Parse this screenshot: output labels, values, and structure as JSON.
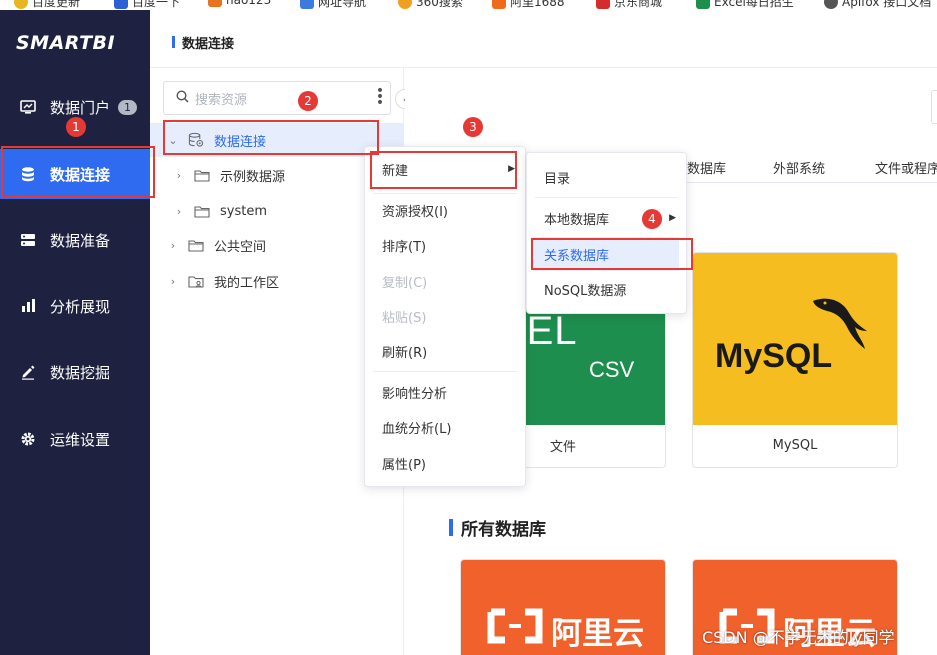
{
  "bookmarks": [
    {
      "label": "百度更新",
      "icon": "chrome-icon",
      "color": "#e8b623"
    },
    {
      "label": "百度一下",
      "icon": "baidu-icon",
      "color": "#2f5fd6"
    },
    {
      "label": "hao123",
      "icon": "hao123-icon",
      "color": "#e8741f"
    },
    {
      "label": "网址导航",
      "icon": "nav-icon",
      "color": "#3b7be0"
    },
    {
      "label": "360搜索",
      "icon": "360-icon",
      "color": "#f0a020"
    },
    {
      "label": "阿里1688",
      "icon": "1688-icon",
      "color": "#f06a1c"
    },
    {
      "label": "京东商城",
      "icon": "jd-icon",
      "color": "#d42b2b"
    },
    {
      "label": "Excel每日招生",
      "icon": "excel-icon",
      "color": "#1d8f4d"
    },
    {
      "label": "Apifox 接口文档",
      "icon": "apifox-icon",
      "color": "#555555"
    }
  ],
  "brand": {
    "logo": "SMARTBI",
    "nav_bg": "#1e2240",
    "accent": "#2f6bf0"
  },
  "nav": {
    "items": [
      {
        "label": "数据门户",
        "badge": "1",
        "icon": "portal-icon"
      },
      {
        "label": "数据连接",
        "icon": "database-icon"
      },
      {
        "label": "数据准备",
        "icon": "prepare-icon"
      },
      {
        "label": "分析展现",
        "icon": "chart-bar-icon"
      },
      {
        "label": "数据挖掘",
        "icon": "edit-icon"
      },
      {
        "label": "运维设置",
        "icon": "gear-icon"
      }
    ]
  },
  "header": {
    "title": "数据连接"
  },
  "tree": {
    "search_placeholder": "搜索资源",
    "nodes": [
      {
        "label": "数据连接",
        "icon": "database-icon",
        "expanded": true,
        "selected": true
      },
      {
        "label": "示例数据源",
        "icon": "folder-icon"
      },
      {
        "label": "system",
        "icon": "folder-icon"
      },
      {
        "label": "公共空间",
        "icon": "folder-icon"
      },
      {
        "label": "我的工作区",
        "icon": "workspace-icon"
      }
    ]
  },
  "main": {
    "tabs": [
      "数据库",
      "外部系统",
      "文件或程序"
    ],
    "section_title": "所有数据库",
    "cards": [
      {
        "label": "文件",
        "thumb_text_1": "XCEL",
        "thumb_text_2": "CSV",
        "color": "#1e8e4e"
      },
      {
        "label": "MySQL",
        "thumb_text_1": "MySQL",
        "color": "#f5bd1f"
      },
      {
        "thumb_text_1": "阿里云",
        "color": "#f0612c"
      },
      {
        "thumb_text_1": "阿里云",
        "color": "#f0612c"
      }
    ]
  },
  "context_menu": {
    "items": [
      {
        "label": "新建",
        "has_submenu": true
      },
      {
        "label": "资源授权(I)"
      },
      {
        "label": "排序(T)"
      },
      {
        "label": "复制(C)",
        "disabled": true
      },
      {
        "label": "粘贴(S)",
        "disabled": true
      },
      {
        "label": "刷新(R)"
      },
      {
        "label": "影响性分析"
      },
      {
        "label": "血统分析(L)"
      },
      {
        "label": "属性(P)"
      }
    ]
  },
  "submenu": {
    "items": [
      {
        "label": "目录"
      },
      {
        "label": "本地数据库",
        "has_submenu": true
      },
      {
        "label": "关系数据库",
        "highlighted": true
      },
      {
        "label": "NoSQL数据源"
      }
    ]
  },
  "annotations": [
    "1",
    "2",
    "3",
    "4"
  ],
  "annotation_color": "#e53935",
  "watermark": "CSDN @不学无术的ly同学"
}
